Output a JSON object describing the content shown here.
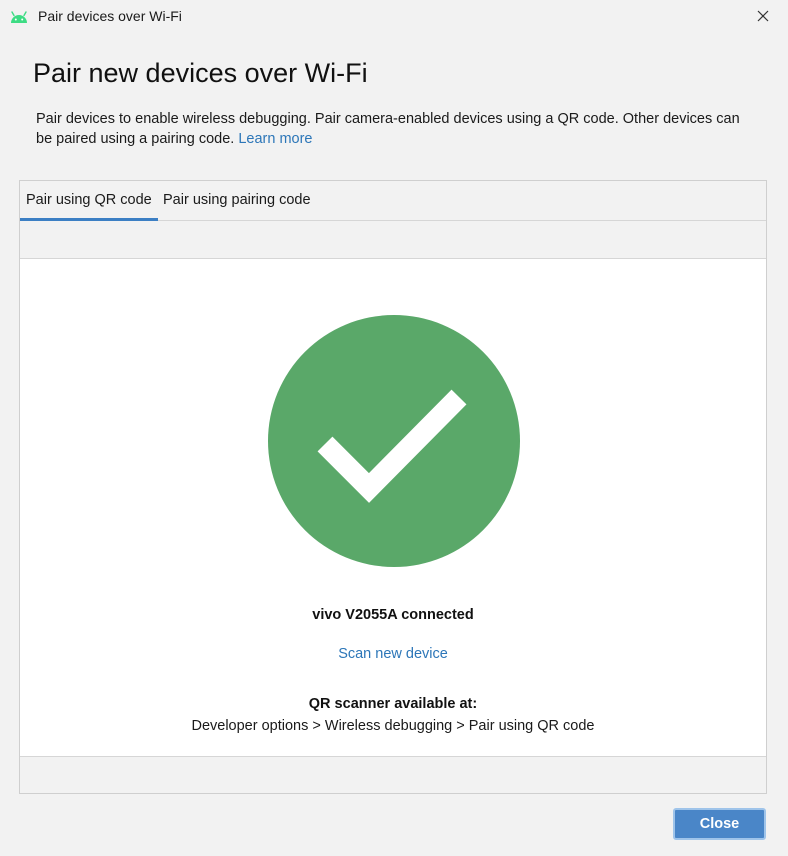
{
  "window": {
    "title": "Pair devices over Wi-Fi",
    "accent_color": "#3ddc84"
  },
  "header": {
    "title": "Pair new devices over Wi-Fi",
    "description": "Pair devices to enable wireless debugging. Pair camera-enabled devices using a QR code. Other devices can be paired using a pairing code.",
    "learn_more": "Learn more"
  },
  "tabs": [
    {
      "label": "Pair using QR code",
      "active": true
    },
    {
      "label": "Pair using pairing code",
      "active": false
    }
  ],
  "status": {
    "icon": "check-circle-icon",
    "icon_color": "#5aa869",
    "connected_text": "vivo V2055A connected",
    "scan_link": "Scan new device",
    "scanner_heading": "QR scanner available at:",
    "scanner_path": "Developer options > Wireless debugging > Pair using QR code"
  },
  "footer": {
    "close_label": "Close"
  }
}
